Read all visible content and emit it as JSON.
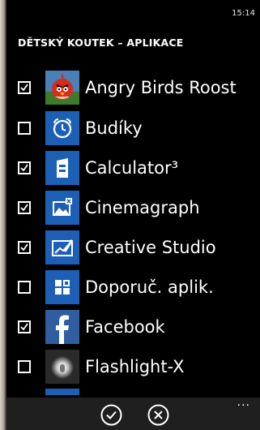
{
  "status_bar": {
    "time": "15:14"
  },
  "page": {
    "title": "DĚTSKÝ KOUTEK – APLIKACE"
  },
  "apps": [
    {
      "name": "Angry Birds Roost",
      "checked": true,
      "icon": "angry-birds-icon"
    },
    {
      "name": "Budíky",
      "checked": false,
      "icon": "alarm-clock-icon"
    },
    {
      "name": "Calculator³",
      "checked": true,
      "icon": "calculator-icon"
    },
    {
      "name": "Cinemagraph",
      "checked": true,
      "icon": "cinemagraph-icon"
    },
    {
      "name": "Creative Studio",
      "checked": true,
      "icon": "creative-studio-icon"
    },
    {
      "name": "Doporuč. aplik.",
      "checked": false,
      "icon": "recommended-apps-icon"
    },
    {
      "name": "Facebook",
      "checked": true,
      "icon": "facebook-icon"
    },
    {
      "name": "Flashlight-X",
      "checked": false,
      "icon": "flashlight-icon"
    }
  ],
  "app_bar": {
    "more": "..."
  },
  "colors": {
    "tile": "#1e5fb6",
    "background": "#000000",
    "app_bar": "#1f1f1f"
  }
}
